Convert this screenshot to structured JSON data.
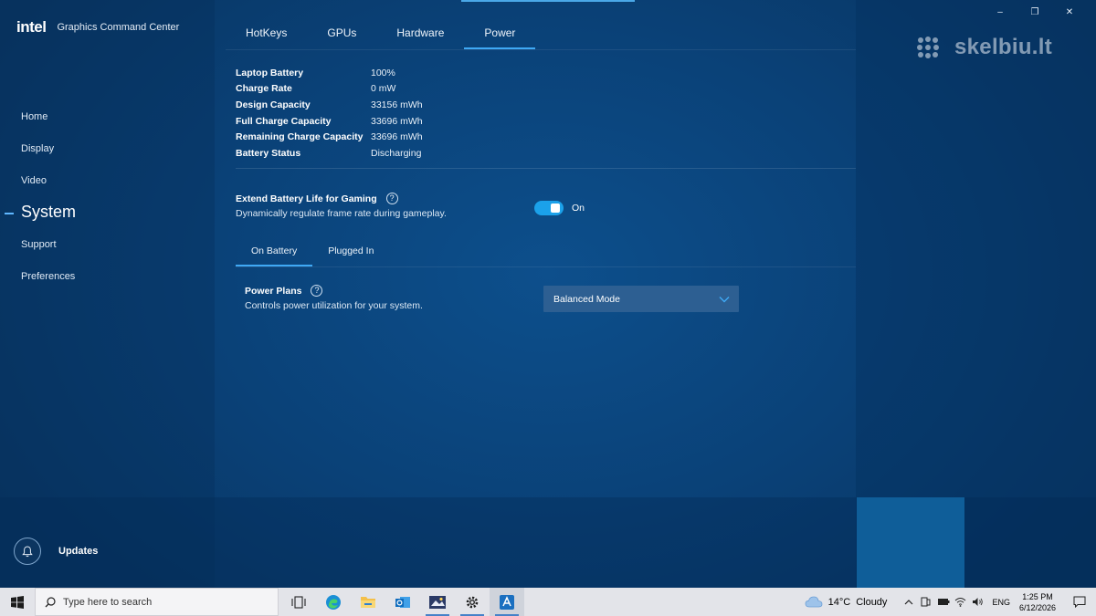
{
  "app": {
    "brand": "intel",
    "title": "Graphics Command Center",
    "accent_color": "#3fa9f5"
  },
  "window_controls": {
    "minimize": "–",
    "maximize": "❐",
    "close": "✕"
  },
  "watermark": "skelbiu.lt",
  "sidebar": {
    "items": [
      {
        "label": "Home",
        "active": false
      },
      {
        "label": "Display",
        "active": false
      },
      {
        "label": "Video",
        "active": false
      },
      {
        "label": "System",
        "active": true
      },
      {
        "label": "Support",
        "active": false
      },
      {
        "label": "Preferences",
        "active": false
      }
    ],
    "updates_label": "Updates",
    "updates_icon": "bell-icon"
  },
  "tabs": [
    {
      "label": "HotKeys",
      "active": false
    },
    {
      "label": "GPUs",
      "active": false
    },
    {
      "label": "Hardware",
      "active": false
    },
    {
      "label": "Power",
      "active": true
    }
  ],
  "battery_info": [
    {
      "key": "Laptop Battery",
      "value": "100%"
    },
    {
      "key": "Charge Rate",
      "value": "0 mW"
    },
    {
      "key": "Design Capacity",
      "value": "33156 mWh"
    },
    {
      "key": "Full Charge Capacity",
      "value": "33696 mWh"
    },
    {
      "key": "Remaining Charge Capacity",
      "value": "33696 mWh"
    },
    {
      "key": "Battery Status",
      "value": "Discharging"
    }
  ],
  "extend_battery": {
    "title": "Extend Battery Life for Gaming",
    "description": "Dynamically regulate frame rate during gameplay.",
    "help": "?",
    "toggle_state": "On",
    "toggle_on": true,
    "toggle_color": "#1ba1ea"
  },
  "subtabs": [
    {
      "label": "On Battery",
      "active": true
    },
    {
      "label": "Plugged In",
      "active": false
    }
  ],
  "power_plans": {
    "title": "Power Plans",
    "description": "Controls power utilization for your system.",
    "help": "?",
    "selected": "Balanced Mode"
  },
  "taskbar": {
    "search_placeholder": "Type here to search",
    "apps": [
      {
        "icon": "task-view-icon",
        "running": false,
        "active": false
      },
      {
        "icon": "edge-icon",
        "running": false,
        "active": false
      },
      {
        "icon": "file-explorer-icon",
        "running": false,
        "active": false
      },
      {
        "icon": "outlook-icon",
        "running": false,
        "active": false
      },
      {
        "icon": "photos-icon",
        "running": true,
        "active": false
      },
      {
        "icon": "settings-icon",
        "running": true,
        "active": false
      },
      {
        "icon": "graphics-command-center-icon",
        "running": true,
        "active": true
      }
    ],
    "weather_temp": "14°C",
    "weather_cond": "Cloudy",
    "language": "ENG",
    "time": "1:25 PM",
    "date": "6/12/2026"
  }
}
